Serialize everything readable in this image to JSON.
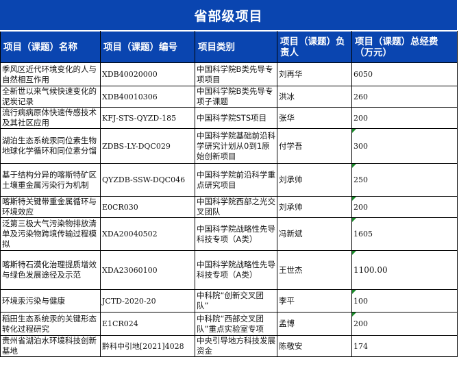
{
  "title": "省部级项目",
  "columns": [
    "项目（课题）名称",
    "项目（课题）编号",
    "项目类别",
    "项目（课题）负责人",
    "项目（课题）总经费（万元）"
  ],
  "rows": [
    {
      "name": "季风区近代环境变化的人与自然相互作用",
      "code": "XDB40020000",
      "category": "中国科学院B类先导专项项目",
      "leader": "刘再华",
      "funding": "6050"
    },
    {
      "name": "全新世以来气候快速变化的泥炭记录",
      "code": "XDB40010306",
      "category": "中国科学院B类先导专项子课题",
      "leader": "洪冰",
      "funding": "260"
    },
    {
      "name": "流行病病原体快速传感技术及其社区应用",
      "code": "KFJ-STS-QYZD-185",
      "category": "中国科学院STS项目",
      "leader": "张华",
      "funding": "200"
    },
    {
      "name": "湖泊生态系统汞同位素生物地球化学循环和同位素分馏",
      "code": "ZDBS-LY-DQC029",
      "category": "中国科学院基础前沿科学研究计划从0到1原始创新项目",
      "leader": "付学吾",
      "funding": "300"
    },
    {
      "name": "基于结构分异的喀斯特矿区土壤重金属污染行为机制",
      "code": "QYZDB-SSW-DQC046",
      "category": "中国科学院前沿科学重点研究项目",
      "leader": "刘承帅",
      "funding": "250"
    },
    {
      "name": "喀斯特关键带重金属循环与环境效应",
      "code": "E0CR030",
      "category": "中国科学院西部之光交叉团队",
      "leader": "刘承帅",
      "funding": "200"
    },
    {
      "name": "泛第三极大气污染物排放清单及污染物跨境传输过程模拟",
      "code": "XDA20040502",
      "category": "中国科学院战略性先导科技专项（A类）",
      "leader": "冯新斌",
      "funding": "1605"
    },
    {
      "name": "喀斯特石漠化治理提质增效与绿色发展途径及示范",
      "code": "XDA23060100",
      "category": "中国科学院战略性先导科技专项（A类）",
      "leader": "王世杰",
      "funding": "1100.00"
    },
    {
      "name": "环境汞污染与健康",
      "code": "JCTD-2020-20",
      "category": "中科院“创新交叉团队”",
      "leader": "李平",
      "funding": "100"
    },
    {
      "name": "稻田生态系统汞的关键形态转化过程研究",
      "code": "E1CR024",
      "category": "中科院“西部交叉团队”重点实验室专项",
      "leader": "孟博",
      "funding": "200"
    },
    {
      "name": "贵州省湖泊水环境科技创新基地",
      "code": "黔科中引地[2021]4028",
      "category": "中央引导地方科技发展资金",
      "leader": "陈敬安",
      "funding": "174"
    }
  ],
  "colors": {
    "header_bg": "#0a45b0",
    "header_text": "#ffffff",
    "flag": "#1a8a2a"
  }
}
